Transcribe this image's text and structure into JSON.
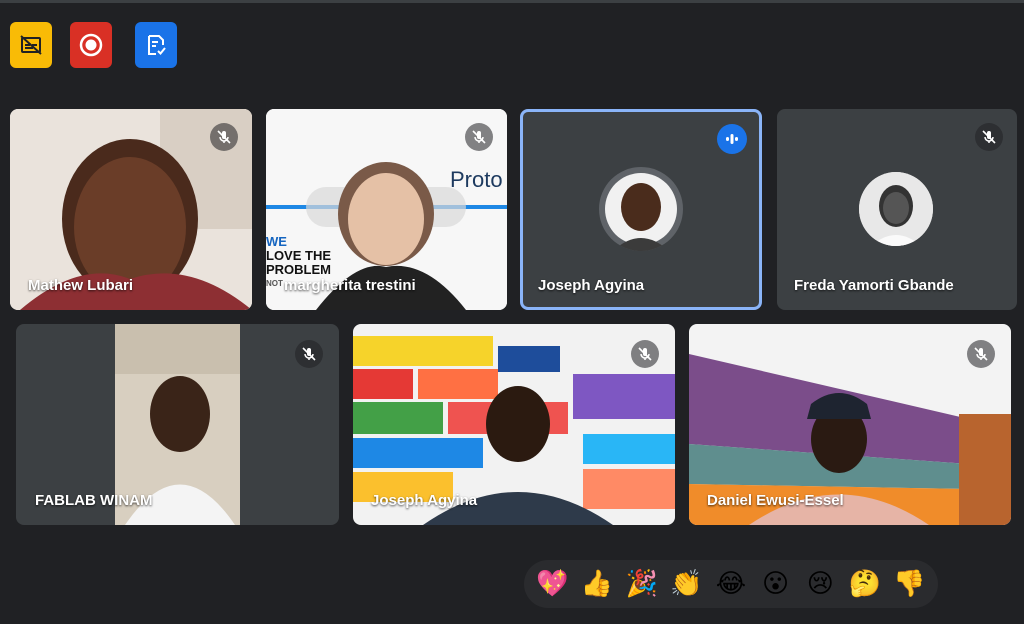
{
  "toolbar": {
    "buttons": [
      {
        "icon": "no-captions-icon",
        "color": "#f9bb06"
      },
      {
        "icon": "record-icon",
        "color": "#d93025"
      },
      {
        "icon": "attendance-icon",
        "color": "#1a73e8"
      }
    ]
  },
  "participants": [
    {
      "name": "Mathew Lubari",
      "muted": true
    },
    {
      "name": "margherita trestini",
      "muted": true,
      "bg_text": {
        "brand": "Proto",
        "slogan1": "WE",
        "slogan2": "LOVE THE",
        "slogan3": "PROBLEM",
        "slogan4": "NOT"
      }
    },
    {
      "name": "Joseph Agyina",
      "muted": false,
      "speaking": true
    },
    {
      "name": "Freda Yamorti Gbande",
      "muted": true
    },
    {
      "name": "FABLAB WINAM",
      "muted": true
    },
    {
      "name": "Joseph Agyina",
      "muted": true
    },
    {
      "name": "Daniel Ewusi-Essel",
      "muted": true
    }
  ],
  "reactions": [
    "💖",
    "👍",
    "🎉",
    "👏",
    "😂",
    "😮",
    "😢",
    "🤔",
    "👎"
  ],
  "colors": {
    "speaking_border": "#8ab4f8",
    "speaking_badge": "#1a73e8",
    "tile_bg": "#3c4043",
    "page_bg": "#202124"
  }
}
